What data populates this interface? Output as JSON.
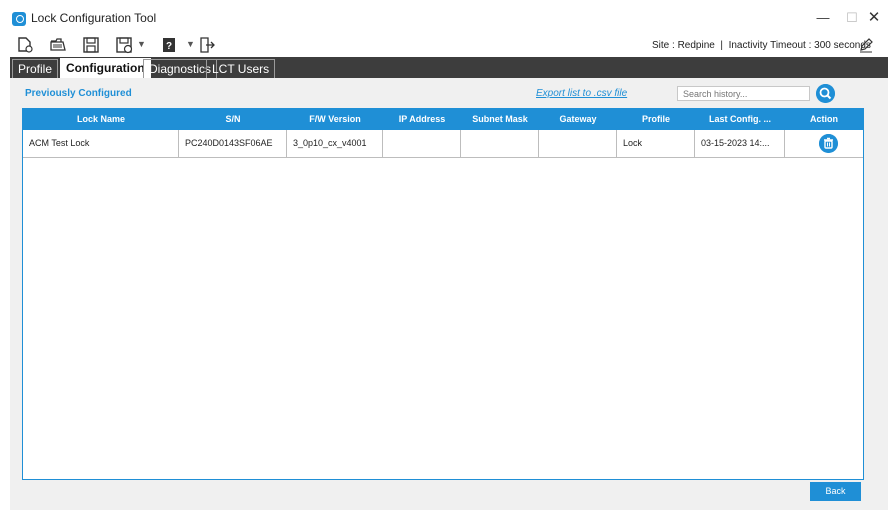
{
  "window": {
    "title": "Lock Configuration Tool",
    "controls": {
      "minimize": "—",
      "maximize": "☐",
      "close": "✕"
    }
  },
  "toolbar": {
    "icons": [
      "new-file-icon",
      "open-folder-icon",
      "save-icon",
      "save-as-icon",
      "help-icon",
      "exit-icon"
    ],
    "site_label": "Site :",
    "site_value": "Redpine",
    "separator": "|",
    "timeout_label": "Inactivity Timeout :",
    "timeout_value": "300 seconds",
    "help_glyph": "?"
  },
  "tabs": [
    {
      "label": "Profile",
      "active": false
    },
    {
      "label": "Configuration",
      "active": true
    },
    {
      "label": "Diagnostics",
      "active": false
    },
    {
      "label": "LCT Users",
      "active": false
    }
  ],
  "section": {
    "title": "Previously Configured",
    "export_link": "Export list to .csv file",
    "search_placeholder": "Search history..."
  },
  "table": {
    "columns": [
      "Lock Name",
      "S/N",
      "F/W Version",
      "IP Address",
      "Subnet Mask",
      "Gateway",
      "Profile",
      "Last Config. ...",
      "Action"
    ],
    "rows": [
      {
        "lock_name": "ACM Test Lock",
        "sn": "PC240D0143SF06AE",
        "fw_version": "3_0p10_cx_v4001",
        "ip_address": "",
        "subnet_mask": "",
        "gateway": "",
        "profile": "Lock",
        "last_config": "03-15-2023 14:..."
      }
    ]
  },
  "buttons": {
    "back": "Back"
  },
  "colors": {
    "accent": "#1f8fd6",
    "tab_strip": "#3d3d3d",
    "panel_bg": "#f0f0f0"
  }
}
